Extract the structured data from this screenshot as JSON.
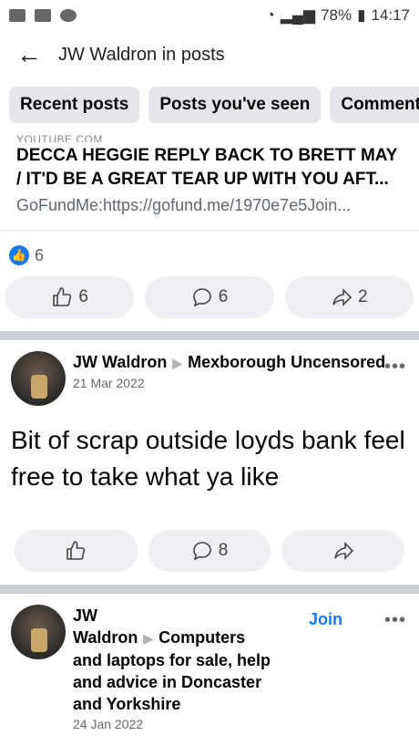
{
  "status": {
    "battery": "78%",
    "time": "14:17"
  },
  "header": {
    "title": "JW Waldron in posts"
  },
  "chips": [
    "Recent posts",
    "Posts you've seen",
    "Comment"
  ],
  "link_post": {
    "source": "YOUTUBE.COM",
    "title": "DECCA HEGGIE REPLY BACK TO BRETT MAY / IT'D BE A GREAT TEAR UP WITH YOU AFT...",
    "desc": "GoFundMe:https://gofund.me/1970e7e5Join...",
    "reaction_count": "6",
    "like_count": "6",
    "comment_count": "6",
    "share_count": "2"
  },
  "post1": {
    "author": "JW Waldron",
    "group": "Mexborough Uncensored",
    "date": "21 Mar 2022",
    "more": "•••",
    "text": "Bit of scrap outside loyds bank feel free to take what ya like",
    "comment_count": "8"
  },
  "post2": {
    "author": "JW Waldron",
    "group": "Computers and laptops for sale, help and advice in Doncaster and Yorkshire",
    "date": "24 Jan 2022",
    "join": "Join",
    "more": "•••"
  }
}
